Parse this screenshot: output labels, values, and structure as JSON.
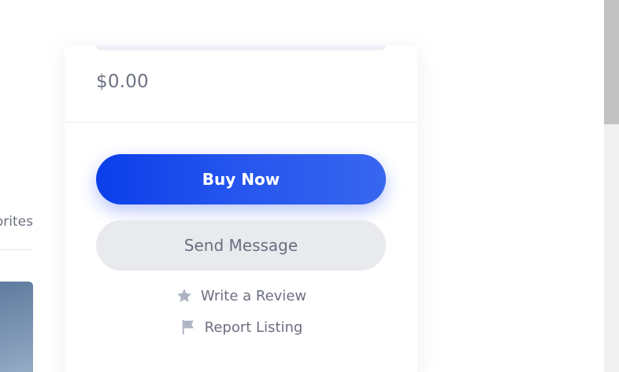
{
  "left_panel": {
    "tab_label": "Favorites"
  },
  "listing_sidebar": {
    "price": "$0.00",
    "buy_button_label": "Buy Now",
    "message_button_label": "Send Message",
    "review_link_label": "Write a Review",
    "report_link_label": "Report Listing",
    "icons": {
      "review": "star-icon",
      "report": "flag-icon"
    }
  },
  "colors": {
    "accent": "#0a3ee9",
    "accent_end": "#3766ef",
    "secondary_button_bg": "#e9eaee",
    "text_muted": "#6b6f7f",
    "icon_color": "#aeb4c3"
  }
}
